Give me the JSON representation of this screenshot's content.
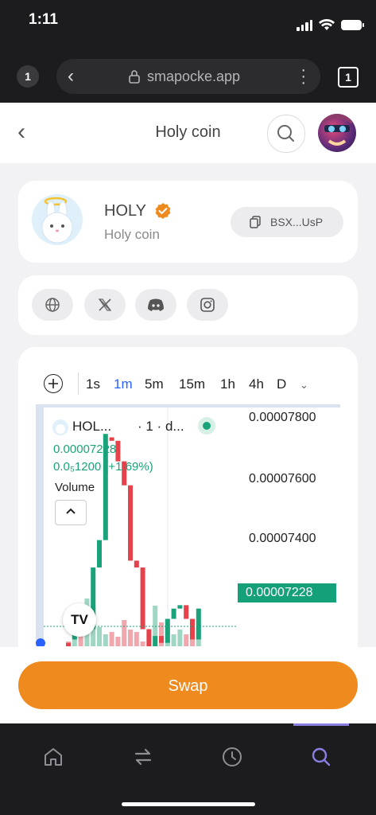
{
  "status_bar": {
    "time": "1:11"
  },
  "browser": {
    "tab_count": "1",
    "url": "smapocke.app",
    "tabs_button": "1"
  },
  "header": {
    "title": "Holy coin"
  },
  "token": {
    "symbol": "HOLY",
    "name": "Holy coin",
    "address": "BSX...UsP"
  },
  "social": [
    "globe-icon",
    "x-icon",
    "discord-icon",
    "instagram-icon"
  ],
  "timeframes": [
    "1s",
    "1m",
    "5m",
    "15m",
    "1h",
    "4h",
    "D"
  ],
  "active_timeframe": "1m",
  "chart_legend": {
    "symbol": "HOL...",
    "interval": "· 1 · d...",
    "price": "0.00007228",
    "change": "0.0₅1200 (+1.69%)",
    "volume_label": "Volume"
  },
  "chart_data": {
    "type": "candlestick",
    "y_ticks": [
      "0.00007800",
      "0.00007600",
      "0.00007400",
      "0.00007200"
    ],
    "ylim": [
      7.17e-05,
      7.83e-05
    ],
    "last_price": "0.00007228",
    "candles": [
      {
        "o": 7.17e-05,
        "c": 7.18e-05,
        "dir": "down"
      },
      {
        "o": 7.19e-05,
        "c": 7.21e-05,
        "dir": "up"
      },
      {
        "o": 7.22e-05,
        "c": 7.21e-05,
        "dir": "down"
      },
      {
        "o": 7.21e-05,
        "c": 7.22e-05,
        "dir": "up"
      },
      {
        "o": 7.22e-05,
        "c": 7.4e-05,
        "dir": "up"
      },
      {
        "o": 7.4e-05,
        "c": 7.48e-05,
        "dir": "up"
      },
      {
        "o": 7.48e-05,
        "c": 7.79e-05,
        "dir": "up"
      },
      {
        "o": 7.78e-05,
        "c": 7.77e-05,
        "dir": "down"
      },
      {
        "o": 7.77e-05,
        "c": 7.71e-05,
        "dir": "down"
      },
      {
        "o": 7.71e-05,
        "c": 7.64e-05,
        "dir": "down"
      },
      {
        "o": 7.64e-05,
        "c": 7.42e-05,
        "dir": "down"
      },
      {
        "o": 7.42e-05,
        "c": 7.4e-05,
        "dir": "down"
      },
      {
        "o": 7.4e-05,
        "c": 7.22e-05,
        "dir": "down"
      },
      {
        "o": 7.22e-05,
        "c": 7.15e-05,
        "dir": "down"
      },
      {
        "o": 7.15e-05,
        "c": 7.2e-05,
        "dir": "up"
      },
      {
        "o": 7.2e-05,
        "c": 7.18e-05,
        "dir": "down"
      },
      {
        "o": 7.18e-05,
        "c": 7.25e-05,
        "dir": "up"
      },
      {
        "o": 7.25e-05,
        "c": 7.28e-05,
        "dir": "up"
      },
      {
        "o": 7.28e-05,
        "c": 7.29e-05,
        "dir": "up"
      },
      {
        "o": 7.29e-05,
        "c": 7.25e-05,
        "dir": "down"
      },
      {
        "o": 7.25e-05,
        "c": 7.19e-05,
        "dir": "down"
      },
      {
        "o": 7.19e-05,
        "c": 7.28e-05,
        "dir": "up"
      }
    ],
    "volumes": [
      0.1,
      0.3,
      0.55,
      1.0,
      0.85,
      0.4,
      0.25,
      0.3,
      0.2,
      0.55,
      0.35,
      0.3,
      0.1,
      0.3,
      0.85,
      0.5,
      0.45,
      0.25,
      0.35,
      0.25,
      0.55,
      0.45
    ]
  },
  "swap": {
    "label": "Swap"
  },
  "nav": [
    "home-icon",
    "swap-arrows-icon",
    "history-icon",
    "search-icon"
  ],
  "colors": {
    "up": "#1aa37a",
    "down": "#e6424b",
    "swap": "#ef8a1f",
    "active_nav": "#8a7fe0"
  }
}
